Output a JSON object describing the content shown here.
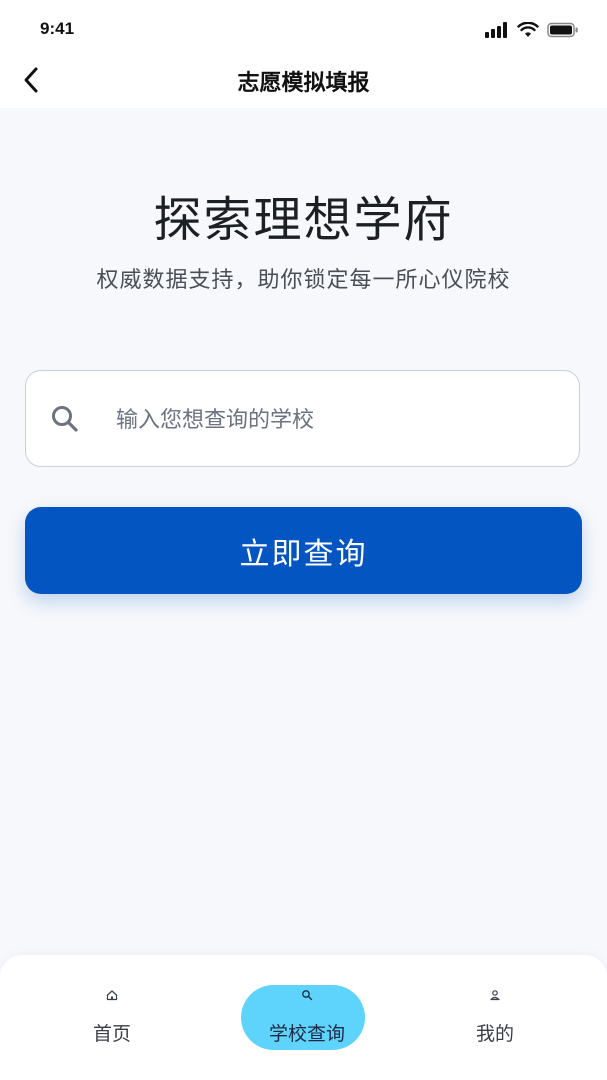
{
  "status_bar": {
    "time": "9:41"
  },
  "nav": {
    "title": "志愿模拟填报"
  },
  "hero": {
    "title": "探索理想学府",
    "subtitle": "权威数据支持，助你锁定每一所心仪院校"
  },
  "search": {
    "placeholder": "输入您想查询的学校",
    "value": ""
  },
  "query_button": {
    "label": "立即查询"
  },
  "colors": {
    "primary": "#0356c2",
    "active_tab": "#5ed3fb",
    "background": "#f6f8fb"
  },
  "tab_bar": {
    "items": [
      {
        "label": "首页",
        "icon": "home-icon",
        "active": false
      },
      {
        "label": "学校查询",
        "icon": "search-icon",
        "active": true
      },
      {
        "label": "我的",
        "icon": "user-icon",
        "active": false
      }
    ]
  }
}
